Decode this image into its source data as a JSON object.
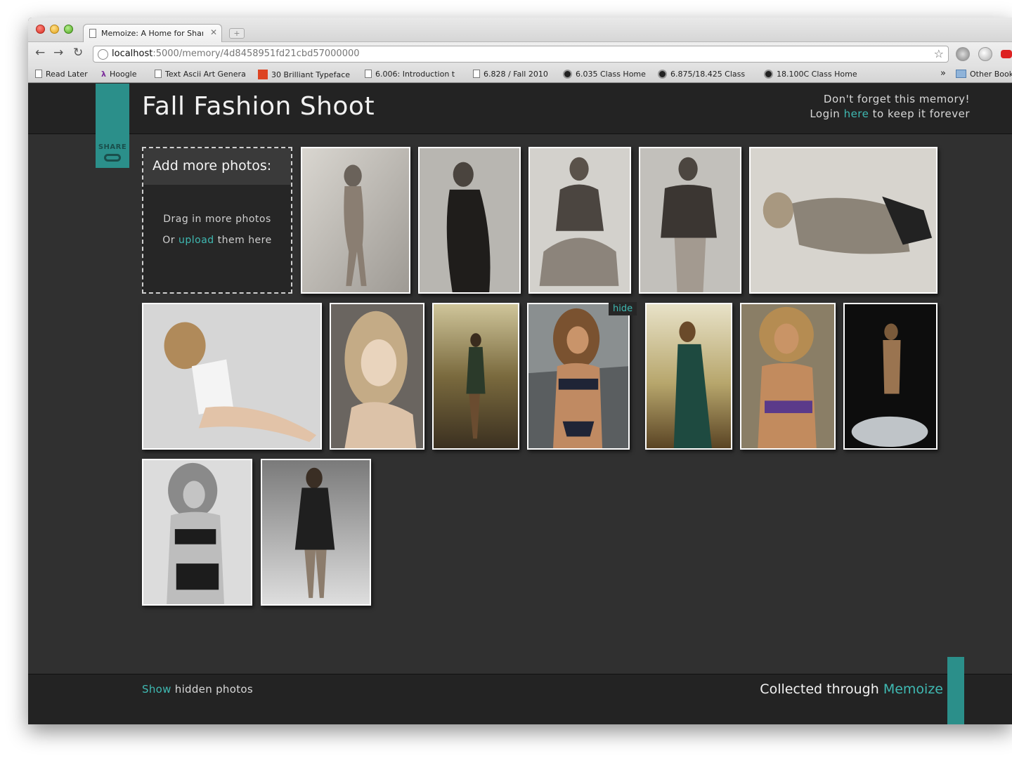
{
  "browser": {
    "tab_title": "Memoize: A Home for Share",
    "tab_close": "✕",
    "new_tab": "+",
    "url_host": "localhost",
    "url_path": ":5000/memory/4d8458951fd21cbd57000000",
    "bookmarks": [
      {
        "label": "Read Later",
        "icon": "page-icon"
      },
      {
        "label": "Hoogle",
        "icon": "lambda-icon"
      },
      {
        "label": "Text Ascii Art Genera",
        "icon": "page-icon"
      },
      {
        "label": "30 Brilliant Typeface",
        "icon": "red-s-icon"
      },
      {
        "label": "6.006: Introduction t",
        "icon": "page-icon"
      },
      {
        "label": "6.828 / Fall 2010",
        "icon": "page-icon"
      },
      {
        "label": "6.035 Class Home",
        "icon": "moon-icon"
      },
      {
        "label": "6.875/18.425 Class",
        "icon": "moon-icon"
      },
      {
        "label": "18.100C Class Home",
        "icon": "moon-icon"
      }
    ],
    "bookmarks_more": "»",
    "other_bookmarks": "Other Bookm"
  },
  "page": {
    "title": "Fall Fashion Shoot",
    "share_label": "SHARE",
    "reminder_line1": "Don't forget this memory!",
    "reminder_login": "Login",
    "reminder_here": "here",
    "reminder_rest": "to keep it forever",
    "add_title": "Add more photos:",
    "add_line1": "Drag in more photos",
    "add_or": "Or",
    "add_upload": "upload",
    "add_them": "them here",
    "hide_label": "hide",
    "footer_show": "Show",
    "footer_hidden": "hidden photos",
    "footer_collected": "Collected through",
    "footer_brand": "Memoize"
  },
  "colors": {
    "accent": "#3fb9b2",
    "ribbon": "#2b8f8a",
    "header_bg": "#232323",
    "page_bg": "#303030"
  }
}
